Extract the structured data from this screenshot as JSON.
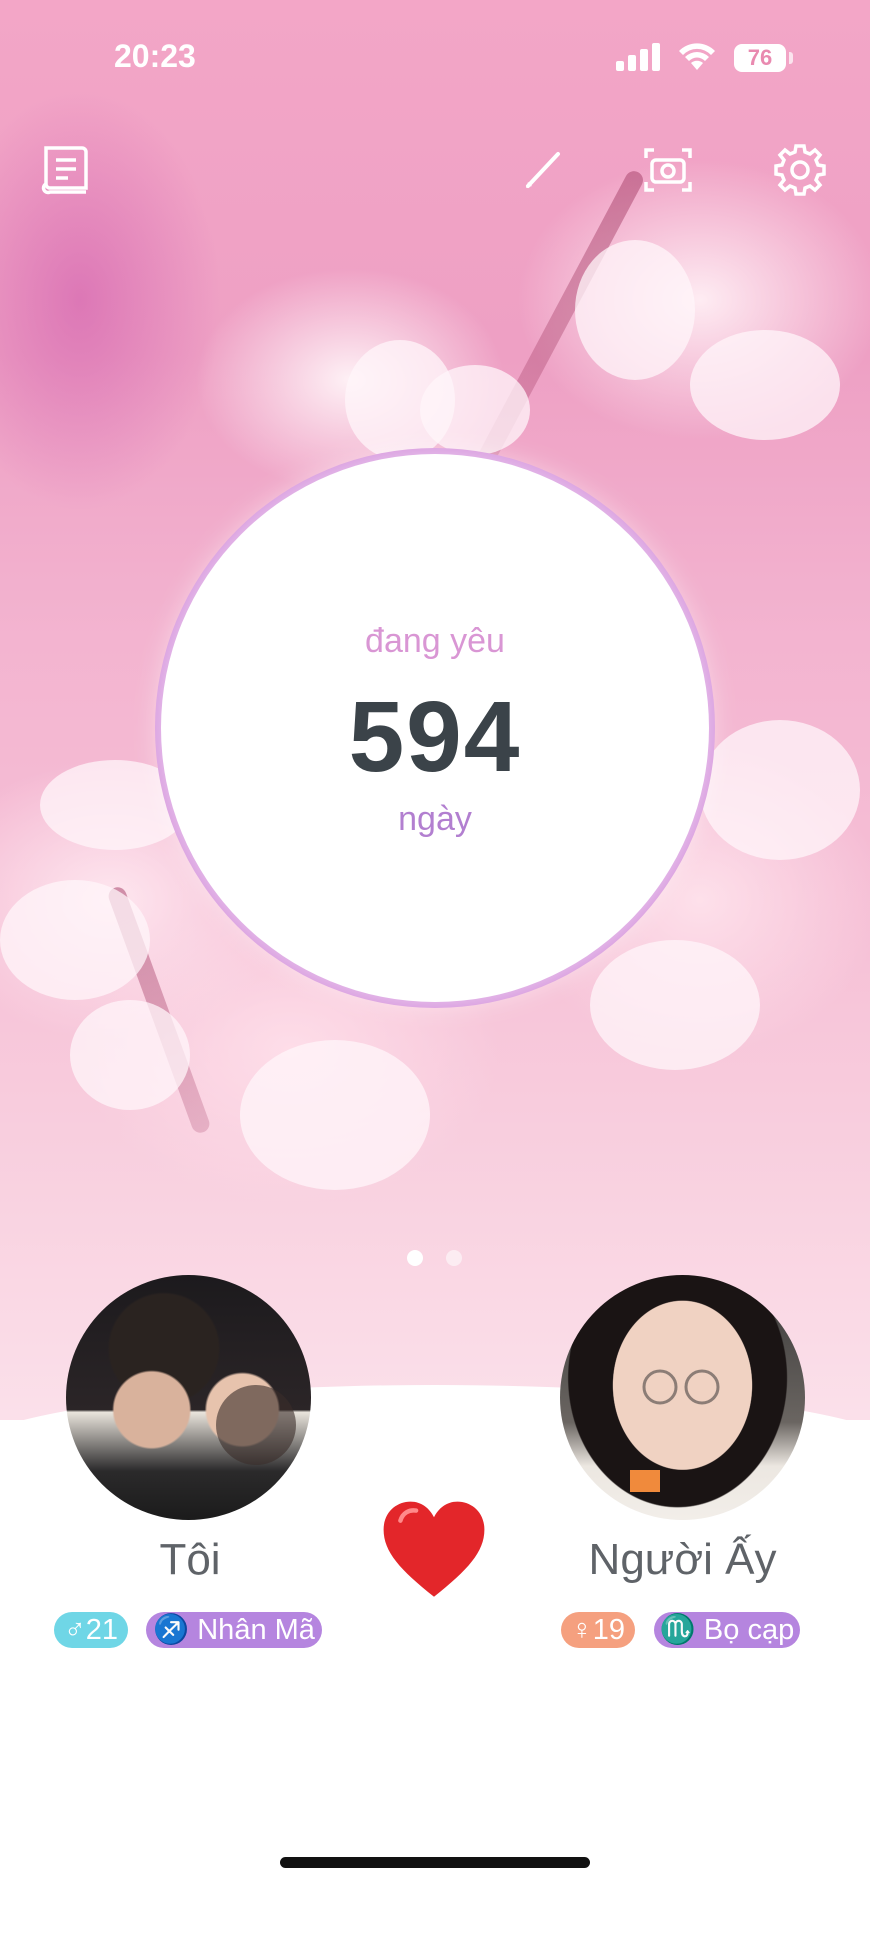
{
  "statusbar": {
    "time": "20:23",
    "battery": "76"
  },
  "toolbar": {
    "left_icon": "book-icon",
    "icons": [
      "pencil-icon",
      "camera-icon",
      "gear-icon"
    ]
  },
  "counter": {
    "status_label": "đang yêu",
    "days": "594",
    "unit_label": "ngày",
    "ring_color": "#d592dc"
  },
  "pager": {
    "pages": 2,
    "active": 1
  },
  "me": {
    "name": "Tôi",
    "age_badge": "♂21",
    "zodiac_badge": "♐ Nhân Mã",
    "age_color": "#6fd6e6",
    "zodiac_color": "#b585df"
  },
  "partner": {
    "name": "Người Ấy",
    "age_badge": "♀19",
    "zodiac_badge": "♏ Bọ cạp",
    "age_color": "#f5a07f",
    "zodiac_color": "#b585df"
  },
  "heart_icon": "red-heart-icon"
}
